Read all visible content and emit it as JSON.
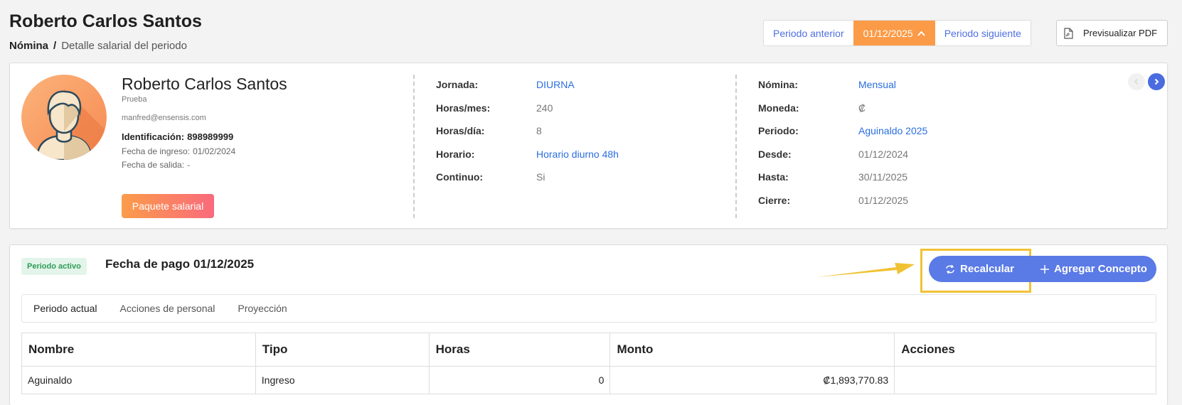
{
  "header": {
    "title": "Roberto Carlos Santos",
    "breadcrumb": {
      "root": "Nómina",
      "separator": "/",
      "current": "Detalle salarial del periodo"
    }
  },
  "period_nav": {
    "prev_label": "Periodo anterior",
    "current_label": "01/12/2025",
    "next_label": "Periodo siguiente"
  },
  "pdf_button": {
    "label": "Previsualizar PDF"
  },
  "employee": {
    "name": "Roberto Carlos Santos",
    "company": "Prueba",
    "email": "manfred@ensensis.com",
    "id_label": "Identificación:",
    "id_value": "898989999",
    "hire_label": "Fecha de ingreso:",
    "hire_value": "01/02/2024",
    "exit_label": "Fecha de salida:",
    "exit_value": "-",
    "salary_package_label": "Paquete salarial"
  },
  "schedule": [
    {
      "label": "Jornada:",
      "value": "DIURNA",
      "link": true
    },
    {
      "label": "Horas/mes:",
      "value": "240",
      "link": false
    },
    {
      "label": "Horas/día:",
      "value": "8",
      "link": false
    },
    {
      "label": "Horario:",
      "value": "Horario diurno 48h",
      "link": true
    },
    {
      "label": "Continuo:",
      "value": "Si",
      "link": false
    }
  ],
  "payroll": [
    {
      "label": "Nómina:",
      "value": "Mensual",
      "link": true
    },
    {
      "label": "Moneda:",
      "value": "₡",
      "link": false
    },
    {
      "label": "Periodo:",
      "value": "Aguinaldo 2025",
      "link": true
    },
    {
      "label": "Desde:",
      "value": "01/12/2024",
      "link": false
    },
    {
      "label": "Hasta:",
      "value": "30/11/2025",
      "link": false
    },
    {
      "label": "Cierre:",
      "value": "01/12/2025",
      "link": false
    }
  ],
  "period": {
    "status_badge": "Periodo activo",
    "pay_date_label": "Fecha de pago",
    "pay_date_value": "01/12/2025",
    "recalc_label": "Recalcular",
    "add_concept_label": "Agregar Concepto",
    "tabs": [
      "Periodo actual",
      "Acciones de personal",
      "Proyección"
    ],
    "active_tab": 0
  },
  "table": {
    "columns": [
      "Nombre",
      "Tipo",
      "Horas",
      "Monto",
      "Acciones"
    ],
    "rows": [
      {
        "nombre": "Aguinaldo",
        "tipo": "Ingreso",
        "horas": "0",
        "monto": "₡1,893,770.83",
        "acciones": ""
      }
    ]
  },
  "colors": {
    "accent_blue": "#5a7ae6",
    "link_blue": "#2a6ee0",
    "orange": "#fb9b47",
    "highlight_yellow": "#f0c233",
    "active_green": "#2f9b58"
  },
  "icons": [
    "chevron-up-icon",
    "pdf-file-icon",
    "avatar-illustration",
    "chevron-left-icon",
    "chevron-right-icon",
    "refresh-icon",
    "plus-icon",
    "annotation-arrow"
  ]
}
